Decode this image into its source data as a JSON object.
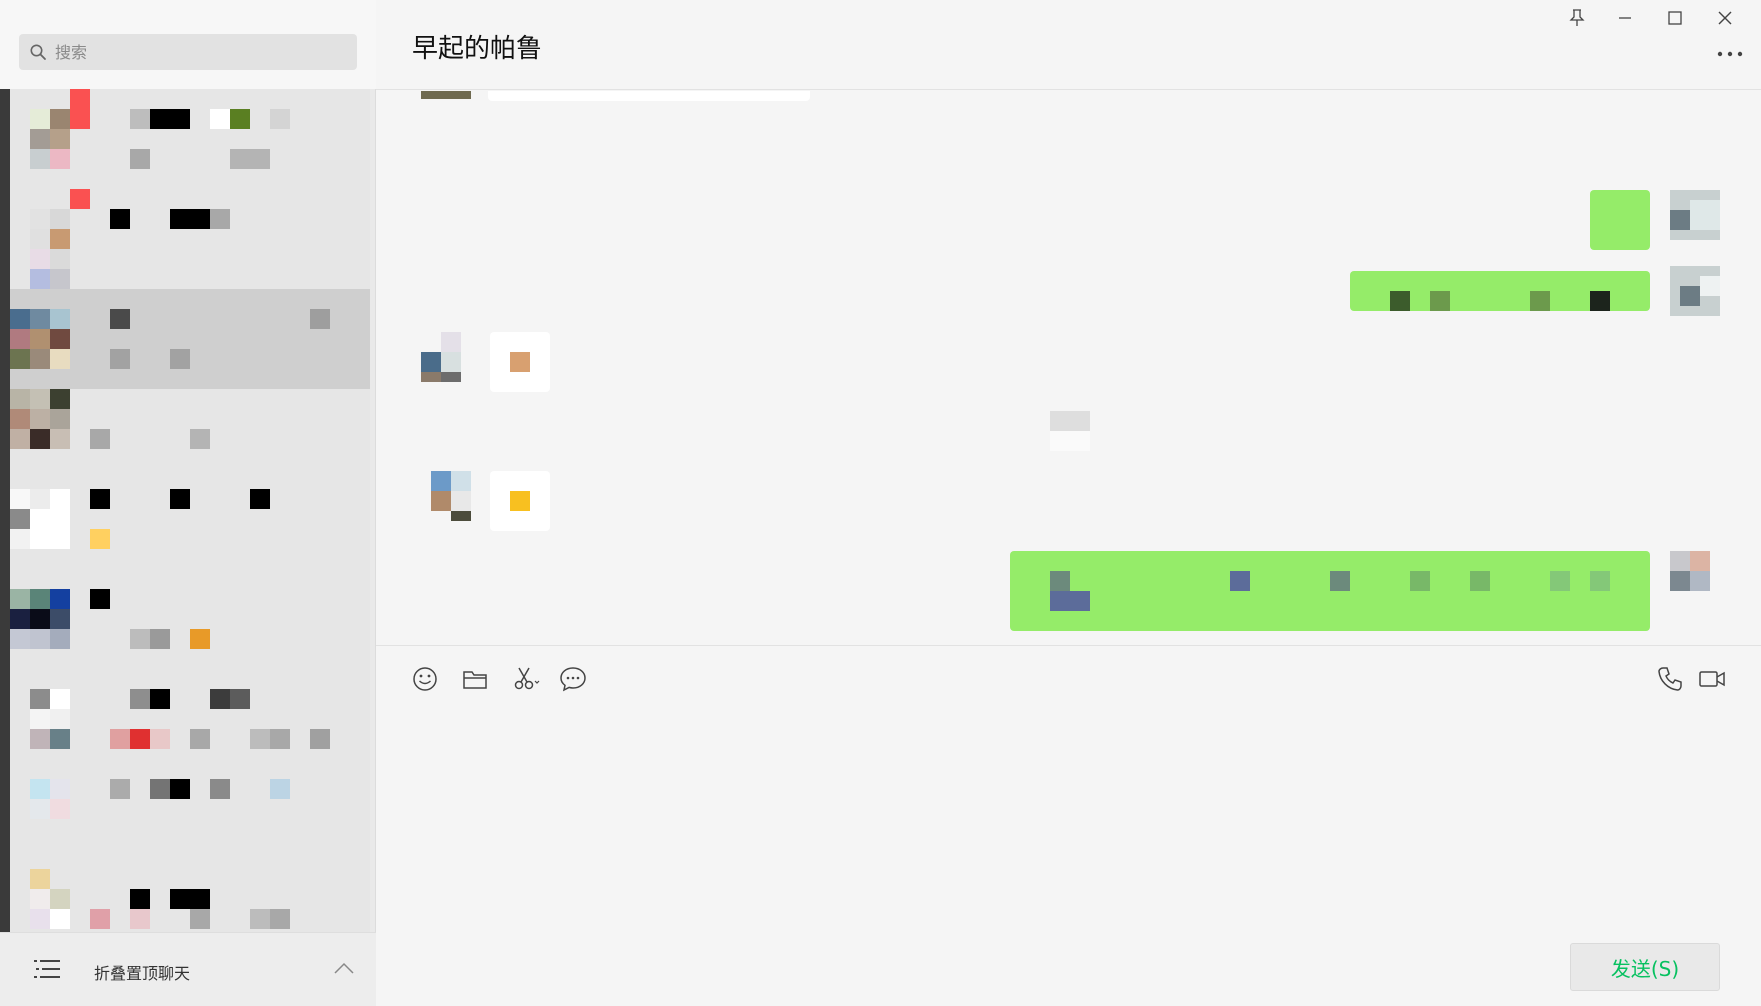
{
  "search": {
    "placeholder": "搜索"
  },
  "chat": {
    "title": "早起的帕鲁"
  },
  "sidebar": {
    "folded_label": "折叠置顶聊天",
    "conversations": [
      {
        "selected": false
      },
      {
        "selected": false
      },
      {
        "selected": true
      },
      {
        "selected": false
      },
      {
        "selected": false
      },
      {
        "selected": false
      },
      {
        "selected": false
      },
      {
        "selected": false
      },
      {
        "selected": false
      }
    ]
  },
  "composer": {
    "send_label": "发送(S)"
  },
  "colors": {
    "bubble_mine": "#95ec69",
    "bubble_theirs": "#ffffff",
    "accent": "#07c160",
    "unread_badge": "#fa5151"
  },
  "icons": {
    "search": "search-icon",
    "pin": "pin-icon",
    "minimize": "minimize-icon",
    "maximize": "maximize-icon",
    "close": "close-icon",
    "more": "more-icon",
    "emoji": "emoji-icon",
    "folder": "folder-icon",
    "scissors": "screenshot-icon",
    "chat_history": "chat-history-icon",
    "phone": "voice-call-icon",
    "video": "video-call-icon",
    "collapse_list": "list-icon",
    "chevron_up": "chevron-up-icon"
  }
}
